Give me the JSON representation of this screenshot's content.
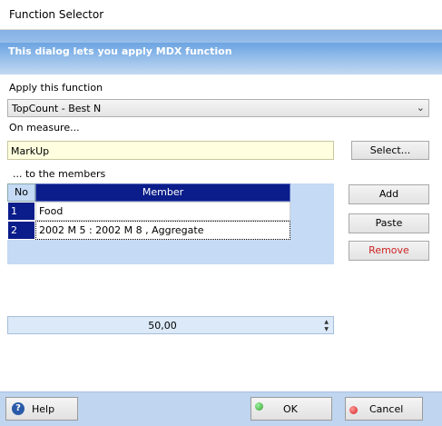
{
  "window": {
    "title": "Function Selector"
  },
  "banner": {
    "text": "This dialog lets you apply MDX function"
  },
  "apply": {
    "label": "Apply this function",
    "selected": "TopCount - Best N"
  },
  "measure": {
    "label": "On measure...",
    "value": "MarkUp",
    "select_button": "Select..."
  },
  "members": {
    "label": "... to the members",
    "columns": [
      "No",
      "Member"
    ],
    "rows": [
      {
        "no": "1",
        "member": "Food"
      },
      {
        "no": "2",
        "member": "2002 M 5 : 2002 M 8 , Aggregate"
      }
    ],
    "add_button": "Add",
    "paste_button": "Paste",
    "remove_button": "Remove"
  },
  "parameter": {
    "value": "50,00"
  },
  "footer": {
    "help": "Help",
    "ok": "OK",
    "cancel": "Cancel"
  },
  "colors": {
    "header": "#0b1d8a",
    "banner": "#4e8ed8",
    "remove_text": "#cc2222",
    "ok_dot": "#2ca02c",
    "cancel_dot": "#d42020"
  }
}
